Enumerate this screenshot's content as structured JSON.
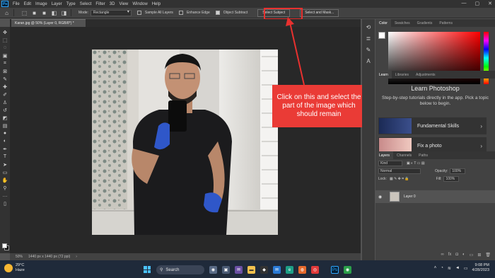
{
  "menubar": {
    "logo": "Ps",
    "items": [
      "File",
      "Edit",
      "Image",
      "Layer",
      "Type",
      "Select",
      "Filter",
      "3D",
      "View",
      "Window",
      "Help"
    ],
    "window_controls": [
      "—",
      "▢",
      "✕"
    ]
  },
  "options": {
    "mode_label": "Mode:",
    "mode_value": "Rectangle",
    "sample_all_layers": "Sample All Layers",
    "enhance_edge": "Enhance Edge",
    "object_subtract": "Object Subtract",
    "select_subject": "Select Subject",
    "select_and_mask": "Select and Mask..."
  },
  "document": {
    "tab_title": "Karan.jpg @ 50% (Layer 0, RGB/8*) *",
    "zoom": "50%",
    "info": "1440 px x 1440 px (72 ppi)"
  },
  "annotation": {
    "callout_text": "Click on this and select the part of the image which should remain",
    "color": "#ea3b36"
  },
  "color_panel": {
    "tabs": [
      "Color",
      "Swatches",
      "Gradients",
      "Patterns"
    ]
  },
  "learn_panel": {
    "tabs": [
      "Learn",
      "Libraries",
      "Adjustments"
    ],
    "title": "Learn Photoshop",
    "description": "Step-by-step tutorials directly in the app. Pick a topic below to begin.",
    "cards": [
      {
        "label": "Fundamental Skills",
        "arrow": "›"
      },
      {
        "label": "Fix a photo",
        "arrow": "›"
      }
    ]
  },
  "layers_panel": {
    "tabs": [
      "Layers",
      "Channels",
      "Paths"
    ],
    "filter_value": "Kind",
    "blend_mode": "Normal",
    "opacity_label": "Opacity:",
    "opacity_value": "100%",
    "lock_label": "Lock:",
    "fill_label": "Fill:",
    "fill_value": "100%",
    "layer_name": "Layer 0"
  },
  "taskbar": {
    "temperature": "29°C",
    "condition": "Haze",
    "search_label": "Search",
    "time": "9:08 PM",
    "date": "4/28/2023"
  }
}
